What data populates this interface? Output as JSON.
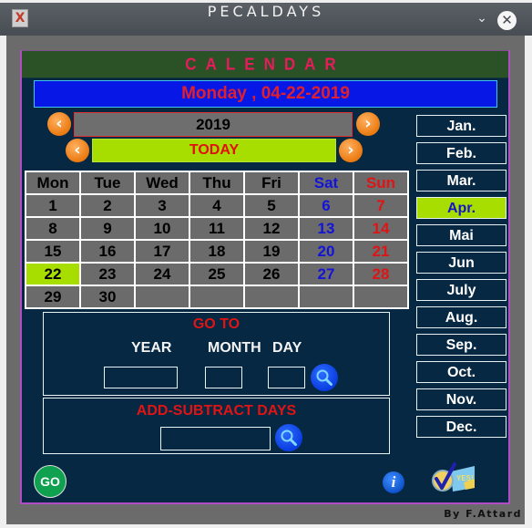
{
  "window": {
    "title": "PECALDAYS",
    "icons": {
      "app": "app-x-icon",
      "minimize": "chevron-down-icon",
      "close": "close-icon"
    }
  },
  "calendar": {
    "header": "CALENDAR",
    "current_date": "Monday , 04-22-2019",
    "year": "2019",
    "today_label": "TODAY",
    "weekdays": [
      "Mon",
      "Tue",
      "Wed",
      "Thu",
      "Fri",
      "Sat",
      "Sun"
    ],
    "weeks": [
      [
        "1",
        "2",
        "3",
        "4",
        "5",
        "6",
        "7"
      ],
      [
        "8",
        "9",
        "10",
        "11",
        "12",
        "13",
        "14"
      ],
      [
        "15",
        "16",
        "17",
        "18",
        "19",
        "20",
        "21"
      ],
      [
        "22",
        "23",
        "24",
        "25",
        "26",
        "27",
        "28"
      ],
      [
        "29",
        "30",
        "",
        "",
        "",
        "",
        ""
      ]
    ],
    "selected_day": "22",
    "colors": {
      "saturday": "#1414d8",
      "sunday": "#e01414",
      "highlight": "#a8dd00"
    }
  },
  "months": [
    "Jan.",
    "Feb.",
    "Mar.",
    "Apr.",
    "Mai",
    "Jun",
    "July",
    "Aug.",
    "Sep.",
    "Oct.",
    "Nov.",
    "Dec."
  ],
  "active_month": "Apr.",
  "goto": {
    "title": "GO TO",
    "year_label": "YEAR",
    "month_label": "MONTH",
    "day_label": "DAY",
    "year_value": "",
    "month_value": "",
    "day_value": ""
  },
  "addsub": {
    "title": "ADD-SUBTRACT DAYS",
    "value": ""
  },
  "footer": {
    "go_label": "GO",
    "info_label": "i",
    "yes_label": "YES!",
    "credit": "By  F.Attard"
  }
}
